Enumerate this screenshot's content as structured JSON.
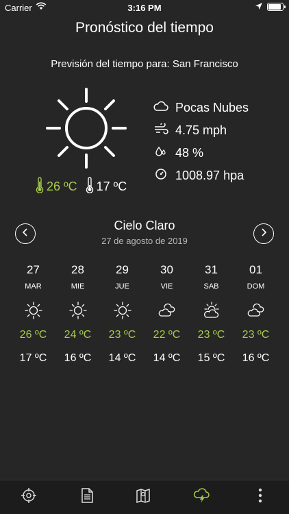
{
  "status_bar": {
    "carrier": "Carrier",
    "time": "3:16 PM"
  },
  "header": {
    "title": "Pronóstico del tiempo"
  },
  "location_line": "Previsión del tiempo para: San Francisco",
  "current": {
    "icon": "sun-icon",
    "details": [
      {
        "icon": "cloud-icon",
        "text": "Pocas Nubes"
      },
      {
        "icon": "wind-icon",
        "text": "4.75 mph"
      },
      {
        "icon": "humidity-icon",
        "text": "48 %"
      },
      {
        "icon": "pressure-icon",
        "text": "1008.97 hpa"
      }
    ],
    "temp_max": "26 ºC",
    "temp_min": "17 ºC"
  },
  "selector": {
    "condition": "Cielo Claro",
    "date": "27 de agosto de 2019"
  },
  "forecast": [
    {
      "day": "27",
      "weekday": "MAR",
      "icon": "sun-icon",
      "hi": "26 ºC",
      "lo": "17 ºC"
    },
    {
      "day": "28",
      "weekday": "MIE",
      "icon": "sun-icon",
      "hi": "24 ºC",
      "lo": "16 ºC"
    },
    {
      "day": "29",
      "weekday": "JUE",
      "icon": "sun-icon",
      "hi": "23 ºC",
      "lo": "14 ºC"
    },
    {
      "day": "30",
      "weekday": "VIE",
      "icon": "clouds-icon",
      "hi": "22 ºC",
      "lo": "14 ºC"
    },
    {
      "day": "31",
      "weekday": "SAB",
      "icon": "partly-cloudy-icon",
      "hi": "23 ºC",
      "lo": "15 ºC"
    },
    {
      "day": "01",
      "weekday": "DOM",
      "icon": "clouds-icon",
      "hi": "23 ºC",
      "lo": "16 ºC"
    }
  ],
  "tab_bar": {
    "tabs": [
      "crosshair-icon",
      "document-icon",
      "map-icon",
      "weather-icon",
      "more-icon"
    ],
    "active": "weather-icon"
  },
  "colors": {
    "background": "#262626",
    "accent": "#a7cc4c",
    "tabbar": "#1c1c1c"
  }
}
